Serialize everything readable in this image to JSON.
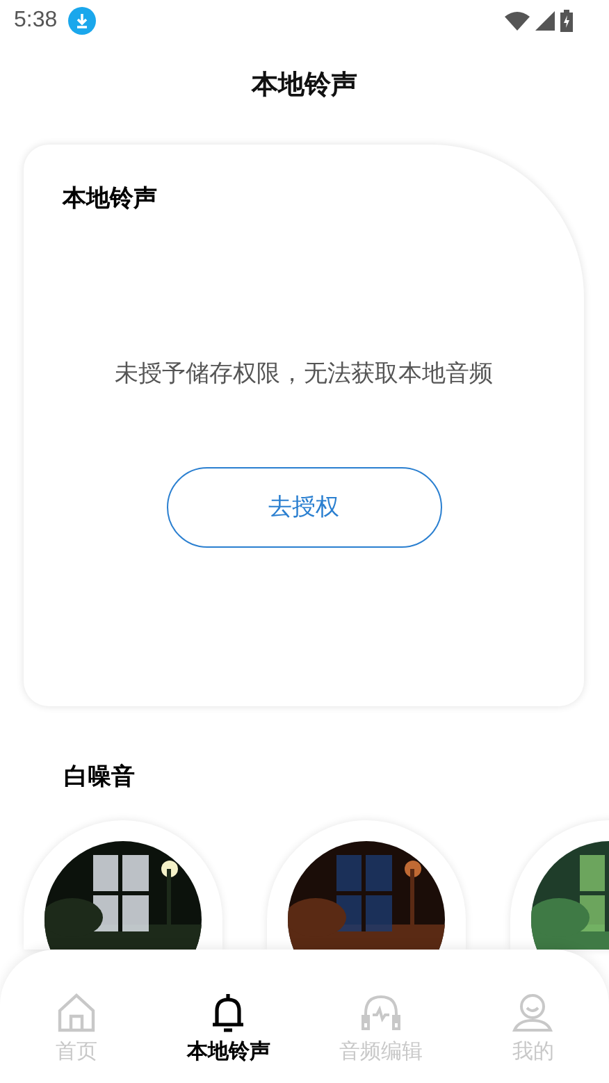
{
  "status_bar": {
    "time": "5:38"
  },
  "header": {
    "title": "本地铃声"
  },
  "local_card": {
    "title": "本地铃声",
    "message": "未授予储存权限，无法获取本地音频",
    "button": "去授权"
  },
  "white_noise": {
    "title": "白噪音"
  },
  "bottom_nav": [
    {
      "label": "首页",
      "selected": false
    },
    {
      "label": "本地铃声",
      "selected": true
    },
    {
      "label": "音频编辑",
      "selected": false
    },
    {
      "label": "我的",
      "selected": false
    }
  ]
}
